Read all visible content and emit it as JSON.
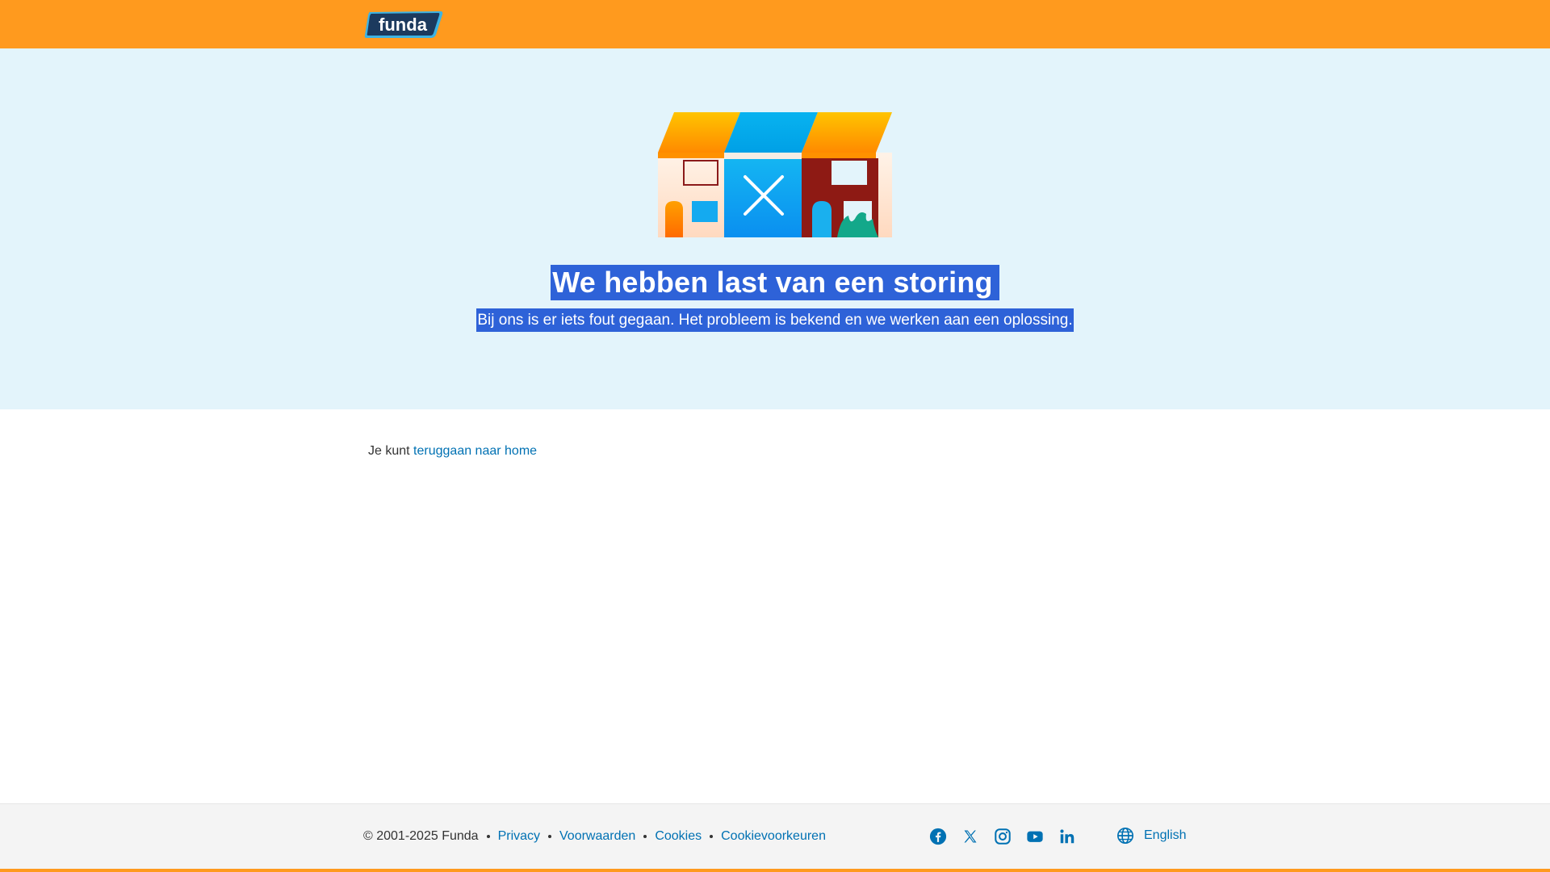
{
  "header": {
    "logo_text": "funda",
    "colors": {
      "background": "#ff9a1e",
      "logo_fill": "#1c3a5e",
      "logo_outline": "#3db3e3"
    }
  },
  "hero": {
    "title": "We hebben last van een storing",
    "subtitle": "Bij ons is er iets fout gegaan. Het probleem is bekend en we werken aan een oplossing.",
    "illustration": "broken-house-illustration",
    "colors": {
      "background": "#e3f4fb",
      "selection": "#2e62d8"
    }
  },
  "main": {
    "back_prefix": "Je kunt",
    "back_link": "teruggaan naar home"
  },
  "footer": {
    "copyright": "© 2001-2025 Funda",
    "links": [
      "Privacy",
      "Voorwaarden",
      "Cookies",
      "Cookievoorkeuren"
    ],
    "socials": [
      "facebook-icon",
      "x-icon",
      "instagram-icon",
      "youtube-icon",
      "linkedin-icon"
    ],
    "language": "English",
    "colors": {
      "link": "#0071b3",
      "background": "#f4f4f4"
    }
  }
}
